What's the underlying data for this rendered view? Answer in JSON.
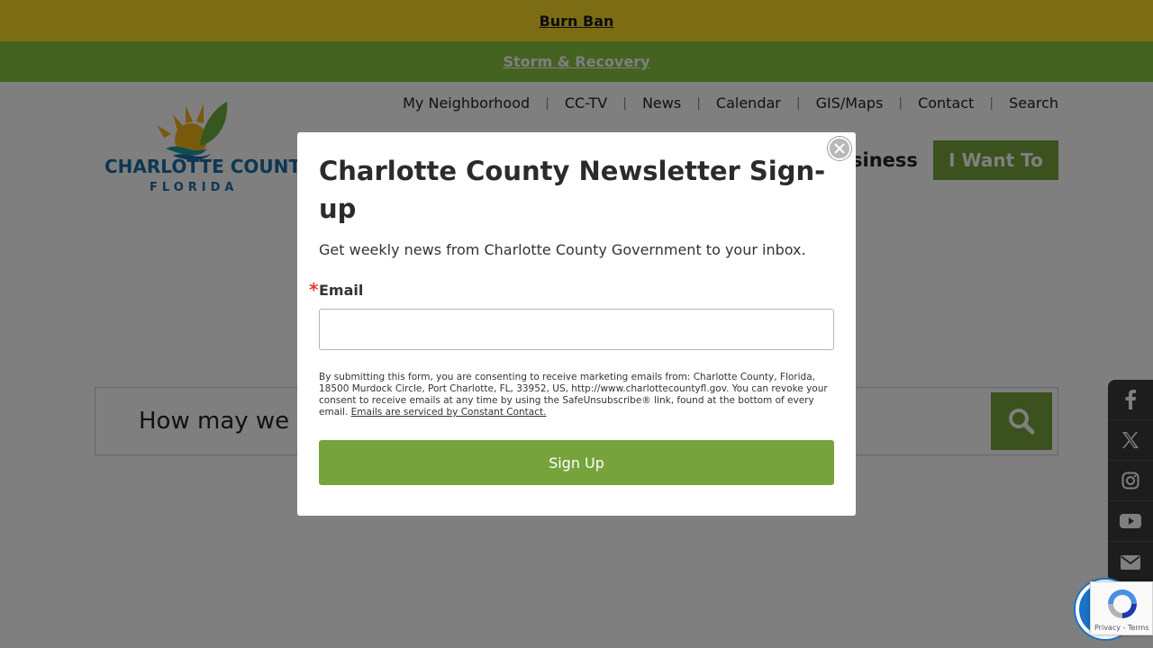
{
  "alerts": {
    "burn_ban": "Burn Ban",
    "storm_recovery": "Storm & Recovery"
  },
  "logo": {
    "brand": "CHARLOTTE COUNTY",
    "sub": "FLORIDA"
  },
  "top_nav": [
    "My Neighborhood",
    "CC-TV",
    "News",
    "Calendar",
    "GIS/Maps",
    "Contact",
    "Search"
  ],
  "main_nav": {
    "partial_item": "siness",
    "cta": "I Want To"
  },
  "search": {
    "placeholder_visible": "How may we"
  },
  "social": [
    "facebook-icon",
    "x-icon",
    "instagram-icon",
    "youtube-icon",
    "email-icon"
  ],
  "modal": {
    "title": "Charlotte County Newsletter Sign-up",
    "description": "Get weekly news from Charlotte County Government to your inbox.",
    "required_marker": "*",
    "email_label": "Email",
    "email_value": "",
    "legal_text": "By submitting this form, you are consenting to receive marketing emails from: Charlotte County, Florida, 18500 Murdock Circle, Port Charlotte, FL, 33952, US, http://www.charlottecountyfl.gov. You can revoke your consent to receive emails at any time by using the SafeUnsubscribe® link, found at the bottom of every email.",
    "legal_link": "Emails are serviced by Constant Contact.",
    "submit_label": "Sign Up"
  },
  "recaptcha": {
    "links": "Privacy - Terms"
  },
  "colors": {
    "burn_ban_bg": "#f9db2a",
    "storm_bg": "#88c540",
    "brand_green": "#76a33c",
    "brand_blue": "#1b6ea6",
    "overlay": "rgba(0,0,0,0.5)"
  }
}
